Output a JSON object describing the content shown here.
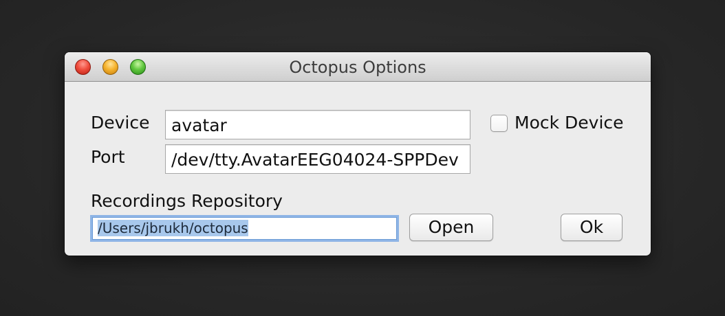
{
  "window": {
    "title": "Octopus Options"
  },
  "form": {
    "device_label": "Device",
    "device_value": "avatar",
    "port_label": "Port",
    "port_value": "/dev/tty.AvatarEEG04024-SPPDev",
    "mock_device_label": "Mock Device",
    "mock_device_checked": false,
    "recordings_label": "Recordings Repository",
    "recordings_value": "/Users/jbrukh/octopus",
    "open_button": "Open",
    "ok_button": "Ok"
  },
  "icons": {
    "close": "close-icon",
    "minimize": "minimize-icon",
    "zoom": "zoom-icon"
  },
  "colors": {
    "close": "#f04f3f",
    "minimize": "#f6b42f",
    "zoom": "#62c840",
    "focus_ring": "#8fb5e6",
    "selection": "#a8c8ec"
  }
}
